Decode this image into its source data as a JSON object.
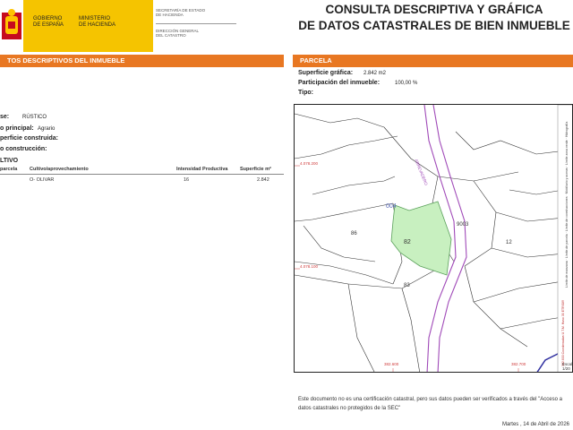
{
  "header": {
    "gobierno": [
      "GOBIERNO",
      "DE ESPAÑA"
    ],
    "ministerio": [
      "MINISTERIO",
      "DE HACIENDA"
    ],
    "secretaria": [
      "SECRETARÍA DE ESTADO",
      "DE HACIENDA"
    ],
    "direccion": [
      "DIRECCIÓN GENERAL",
      "DEL CATASTRO"
    ],
    "title_lines": [
      "CONSULTA DESCRIPTIVA Y GRÁFICA",
      "DE DATOS CATASTRALES DE BIEN INMUEBLE"
    ],
    "colors": {
      "flag_red": "#c60b1e",
      "flag_yellow": "#ffc400",
      "band_yellow": "#f5c400",
      "orange": "#e87722"
    }
  },
  "left": {
    "section_title": "TOS DESCRIPTIVOS DEL INMUEBLE",
    "clase_label": "se:",
    "clase_value": "RÚSTICO",
    "uso_label": "o principal:",
    "uso_value": "Agrario",
    "superficie_label": "perficie construida:",
    "construccion_label": "o construcción:",
    "cultivo_title": "LTIVO",
    "table": {
      "headers": [
        "parcela",
        "Cultivo/aprovechamiento",
        "Intensidad Productiva",
        "Superficie m²"
      ],
      "rows": [
        [
          "",
          "O- OLIVAR",
          "16",
          "2.842"
        ]
      ]
    }
  },
  "right": {
    "section_title": "PARCELA",
    "superficie_label": "Superficie gráfica:",
    "superficie_value": "2.842 m2",
    "participacion_label": "Participación del inmueble:",
    "participacion_value": "100,00 %",
    "tipo_label": "Tipo:",
    "map": {
      "parcel_id": "004",
      "parcel_number": "82",
      "labels": [
        "86",
        "83",
        "9003",
        "12"
      ],
      "road_label": "ABREVADERO",
      "coords": [
        "4.078.200",
        "4.078.100",
        "382.600",
        "382.700"
      ],
      "side_legend": [
        "Límite de manzana",
        "Límite de parcela",
        "Límite de construcciones",
        "Mobiliario y aceras",
        "Límite zona verde",
        "Hidrografía"
      ],
      "side_ref": "382.600 Coordenadas U.T.M. Huso 30 ETRS89",
      "scale_label": "Escal",
      "scale_value": "1/20",
      "colors": {
        "parcel_fill": "#c8f0c0",
        "parcel_stroke": "#5aa05a",
        "road": "#a04ab8",
        "coord": "#d04040",
        "water": "#3030a0"
      }
    },
    "note": "Este documento no es una certificación catastral, pero sus datos pueden ser verificados a través del \"Acceso a datos catastrales no protegidos de la SEC\"",
    "date": "Martes , 14 de Abril de 2026"
  }
}
